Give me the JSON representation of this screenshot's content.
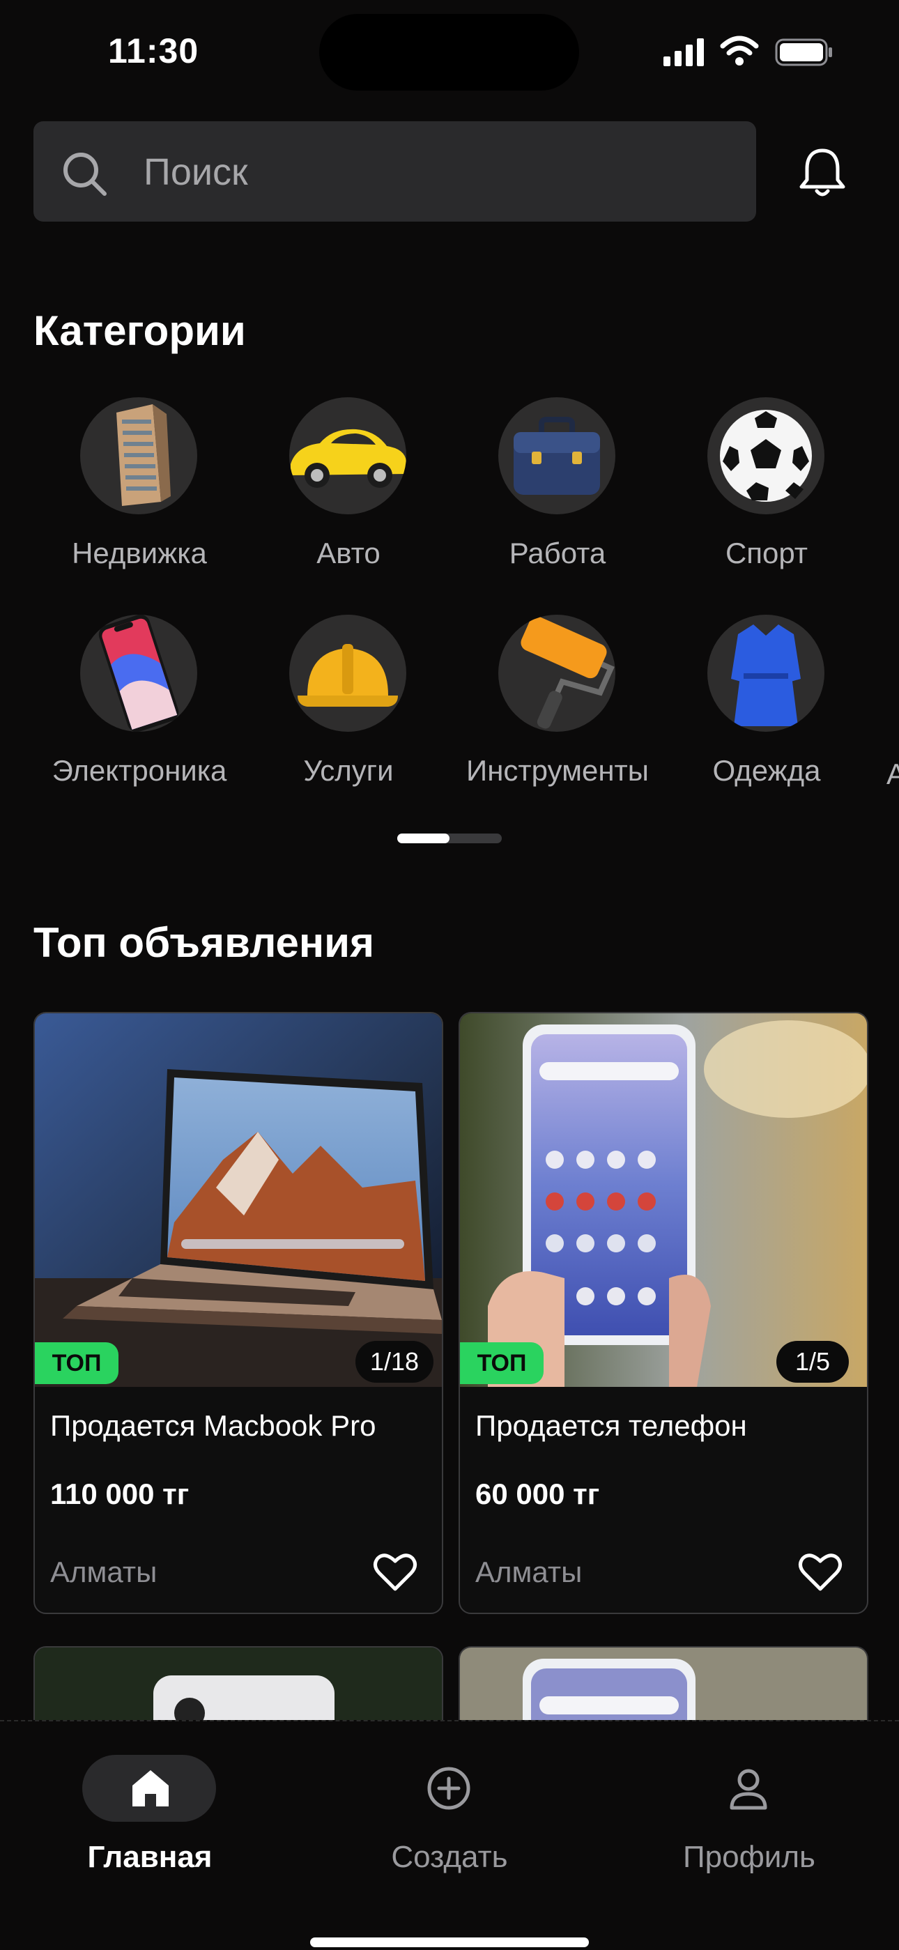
{
  "status_bar": {
    "time": "11:30"
  },
  "search": {
    "placeholder": "Поиск"
  },
  "categories": {
    "title": "Категории",
    "items": [
      {
        "label": "Недвижка",
        "icon": "building-icon"
      },
      {
        "label": "Авто",
        "icon": "car-icon"
      },
      {
        "label": "Работа",
        "icon": "briefcase-icon"
      },
      {
        "label": "Спорт",
        "icon": "soccer-ball-icon"
      },
      {
        "label": "Электроника",
        "icon": "smartphone-icon"
      },
      {
        "label": "Услуги",
        "icon": "hard-hat-icon"
      },
      {
        "label": "Инструменты",
        "icon": "paint-roller-icon"
      },
      {
        "label": "Одежда",
        "icon": "dress-icon"
      }
    ],
    "partial_label": "А"
  },
  "top_ads": {
    "title": "Топ объявления",
    "items": [
      {
        "badge": "ТОП",
        "photo_count": "1/18",
        "title": "Продается Macbook Pro",
        "price": "110 000 тг",
        "city": "Алматы"
      },
      {
        "badge": "ТОП",
        "photo_count": "1/5",
        "title": "Продается телефон",
        "price": "60 000 тг",
        "city": "Алматы"
      }
    ]
  },
  "bottom_nav": {
    "items": [
      {
        "label": "Главная",
        "icon": "home-icon",
        "active": true
      },
      {
        "label": "Создать",
        "icon": "plus-circle-icon",
        "active": false
      },
      {
        "label": "Профиль",
        "icon": "user-icon",
        "active": false
      }
    ]
  },
  "colors": {
    "background": "#0b0a0a",
    "surface": "#2a2a2c",
    "accent_green": "#2ad35f"
  }
}
